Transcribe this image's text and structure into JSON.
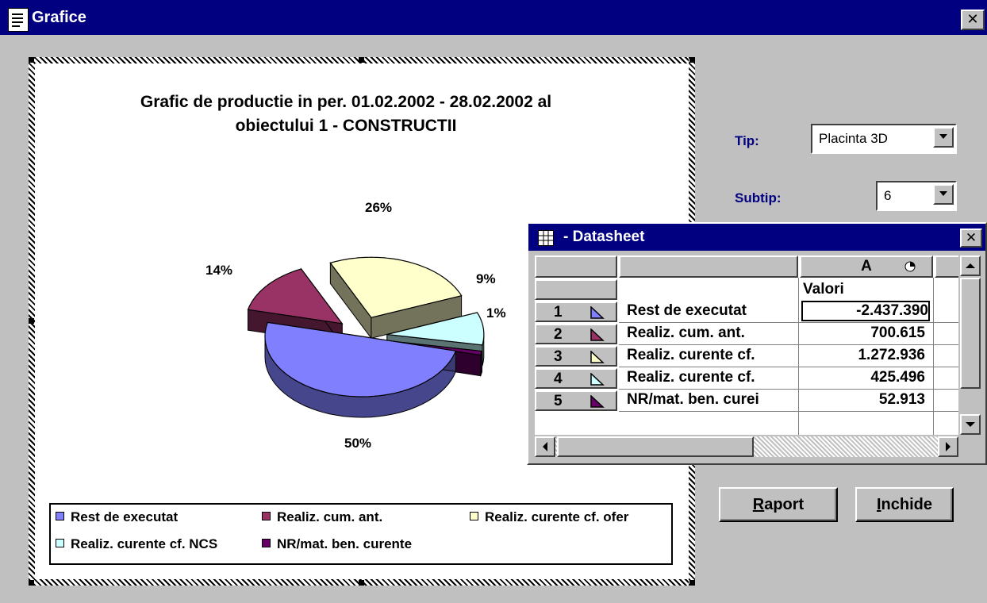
{
  "window": {
    "title": "Grafice"
  },
  "chart_data": {
    "type": "pie",
    "subtype": "3D exploded",
    "title": "Grafic de productie in per. 01.02.2002 - 28.02.2002 al obiectului 1 - CONSTRUCTII",
    "title_line1": "Grafic de productie in per. 01.02.2002 - 28.02.2002 al",
    "title_line2": "obiectului 1 - CONSTRUCTII",
    "series": [
      {
        "name": "Rest de executat",
        "value": -2437390,
        "percent_label": "50%",
        "color": "#8080ff"
      },
      {
        "name": "Realiz. cum. ant.",
        "value": 700615,
        "percent_label": "14%",
        "color": "#993366"
      },
      {
        "name": "Realiz. curente cf. ofer",
        "value": 1272936,
        "percent_label": "26%",
        "color": "#ffffcc"
      },
      {
        "name": "Realiz. curente cf. NCS",
        "value": 425496,
        "percent_label": "9%",
        "color": "#ccffff"
      },
      {
        "name": "NR/mat. ben. curente",
        "value": 52913,
        "percent_label": "1%",
        "color": "#660066"
      }
    ],
    "legend_position": "bottom"
  },
  "controls": {
    "tip_label": "Tip:",
    "tip_value": "Placinta 3D",
    "subtip_label": "Subtip:",
    "subtip_value": "6",
    "raport_label": "Raport",
    "raport_key": "R",
    "inchide_label": "Inchide",
    "inchide_key": "I"
  },
  "datasheet": {
    "title": " - Datasheet",
    "column_header": "A",
    "value_header": "Valori",
    "rows": [
      {
        "num": "1",
        "label": "Rest de executat",
        "value": "-2.437.390"
      },
      {
        "num": "2",
        "label": "Realiz. cum. ant.",
        "value": "700.615"
      },
      {
        "num": "3",
        "label": "Realiz. curente cf.",
        "value": "1.272.936"
      },
      {
        "num": "4",
        "label": "Realiz. curente cf.",
        "value": "425.496"
      },
      {
        "num": "5",
        "label": "NR/mat. ben. curei",
        "value": "52.913"
      }
    ]
  },
  "icons": {
    "close": "close-icon",
    "dropdown": "chevron-down-icon",
    "window": "form-icon",
    "datasheet": "grid-icon"
  }
}
